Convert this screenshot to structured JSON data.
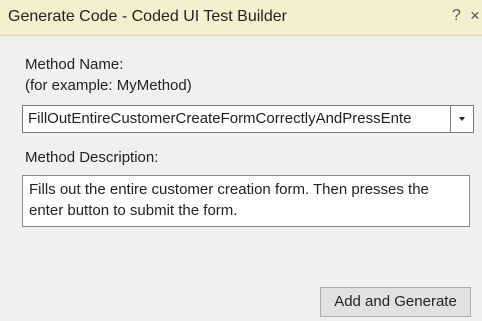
{
  "window": {
    "title": "Generate Code - Coded UI Test Builder",
    "help_glyph": "?",
    "close_glyph": "×",
    "title_bar_color": "#f1f0cf"
  },
  "form": {
    "method_name_label": "Method Name:",
    "method_name_hint": "(for example: MyMethod)",
    "method_name_value": "FillOutEntireCustomerCreateFormCorrectlyAndPressEnte",
    "method_description_label": "Method Description:",
    "method_description_value": "Fills out the entire customer creation form. Then presses the enter button to submit the form."
  },
  "buttons": {
    "add_and_generate_label": "Add and Generate"
  },
  "icons": {
    "help": "help-icon",
    "close": "close-icon",
    "dropdown": "chevron-down-icon"
  }
}
